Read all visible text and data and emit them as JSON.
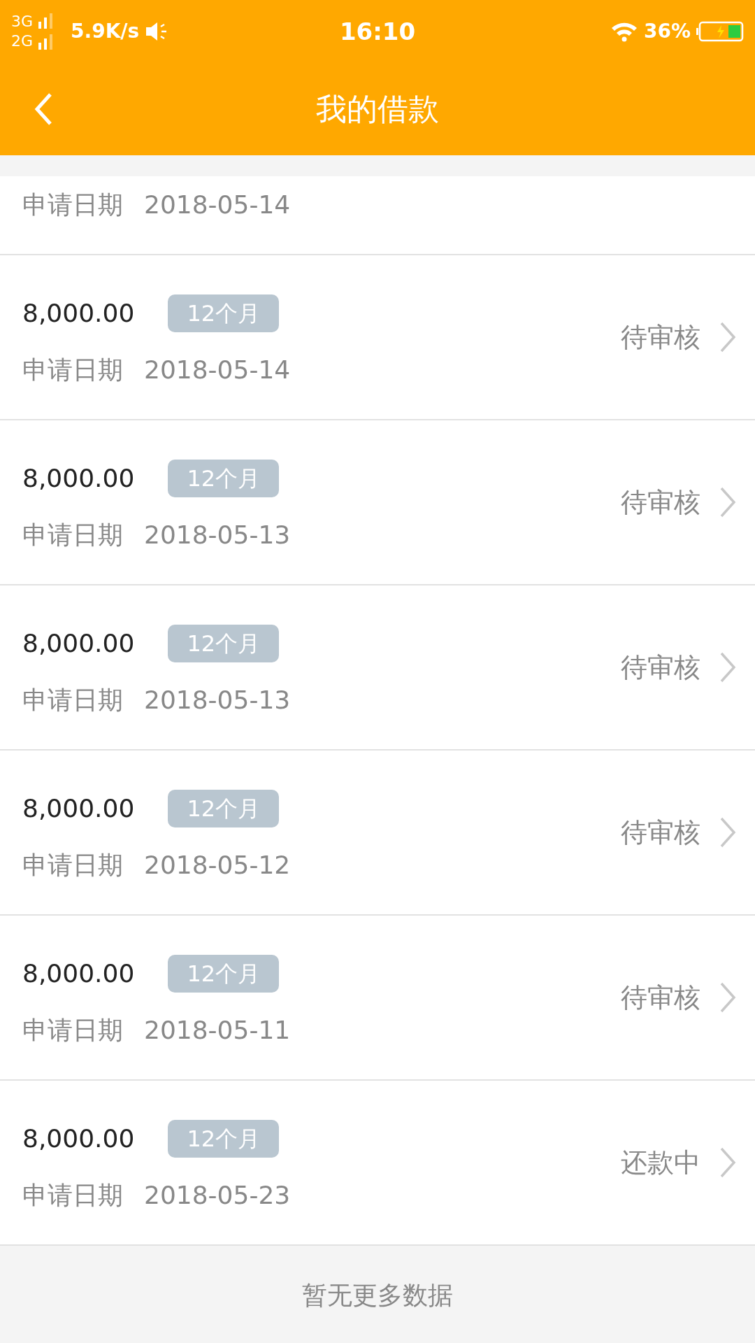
{
  "status_bar": {
    "network_1": "3G",
    "network_2": "2G",
    "speed": "5.9K/s",
    "time": "16:10",
    "battery": "36%"
  },
  "nav": {
    "title": "我的借款"
  },
  "partial_row": {
    "date_label": "申请日期",
    "date": "2018-05-14"
  },
  "loans": [
    {
      "amount": "8,000.00",
      "term": "12个月",
      "date_label": "申请日期",
      "date": "2018-05-14",
      "status": "待审核"
    },
    {
      "amount": "8,000.00",
      "term": "12个月",
      "date_label": "申请日期",
      "date": "2018-05-13",
      "status": "待审核"
    },
    {
      "amount": "8,000.00",
      "term": "12个月",
      "date_label": "申请日期",
      "date": "2018-05-13",
      "status": "待审核"
    },
    {
      "amount": "8,000.00",
      "term": "12个月",
      "date_label": "申请日期",
      "date": "2018-05-12",
      "status": "待审核"
    },
    {
      "amount": "8,000.00",
      "term": "12个月",
      "date_label": "申请日期",
      "date": "2018-05-11",
      "status": "待审核"
    },
    {
      "amount": "8,000.00",
      "term": "12个月",
      "date_label": "申请日期",
      "date": "2018-05-23",
      "status": "还款中"
    }
  ],
  "footer": "暂无更多数据"
}
